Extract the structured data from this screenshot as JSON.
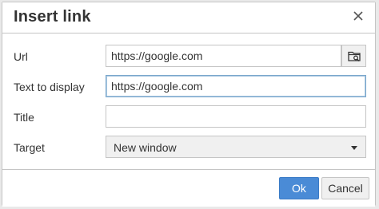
{
  "dialog": {
    "title": "Insert link",
    "close_icon": "close-icon"
  },
  "form": {
    "url": {
      "label": "Url",
      "value": "https://google.com",
      "picker_icon": "folder-search-icon"
    },
    "text_to_display": {
      "label": "Text to display",
      "value": "https://google.com"
    },
    "title": {
      "label": "Title",
      "value": ""
    },
    "target": {
      "label": "Target",
      "value": "New window"
    }
  },
  "footer": {
    "ok_label": "Ok",
    "cancel_label": "Cancel"
  },
  "colors": {
    "primary_button": "#4a8bd6",
    "focus_border": "#7aa7cc"
  }
}
